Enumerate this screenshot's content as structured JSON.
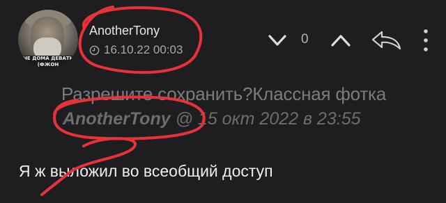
{
  "comment": {
    "author": "AnotherTony",
    "timestamp": "16.10.22 00:03",
    "votes": {
      "count": "0"
    },
    "quote": {
      "text": "Разрешите сохранить?Классная фотка",
      "author": "AnotherTony",
      "at_sign": "@",
      "date": "15 окт 2022 в 23:55"
    },
    "body": "Я ж выложил во всеобщий доступ"
  },
  "avatar": {
    "sign_text": "НЕ ДОМА ДЕВАТЬ (ФЖОН"
  },
  "icons": {
    "clock": "clock-icon",
    "down": "chevron-down-icon",
    "up": "chevron-up-icon",
    "reply": "reply-icon",
    "more": "more-vertical-icon"
  },
  "colors": {
    "background": "#1e1e20",
    "annotation": "#e8323a"
  }
}
